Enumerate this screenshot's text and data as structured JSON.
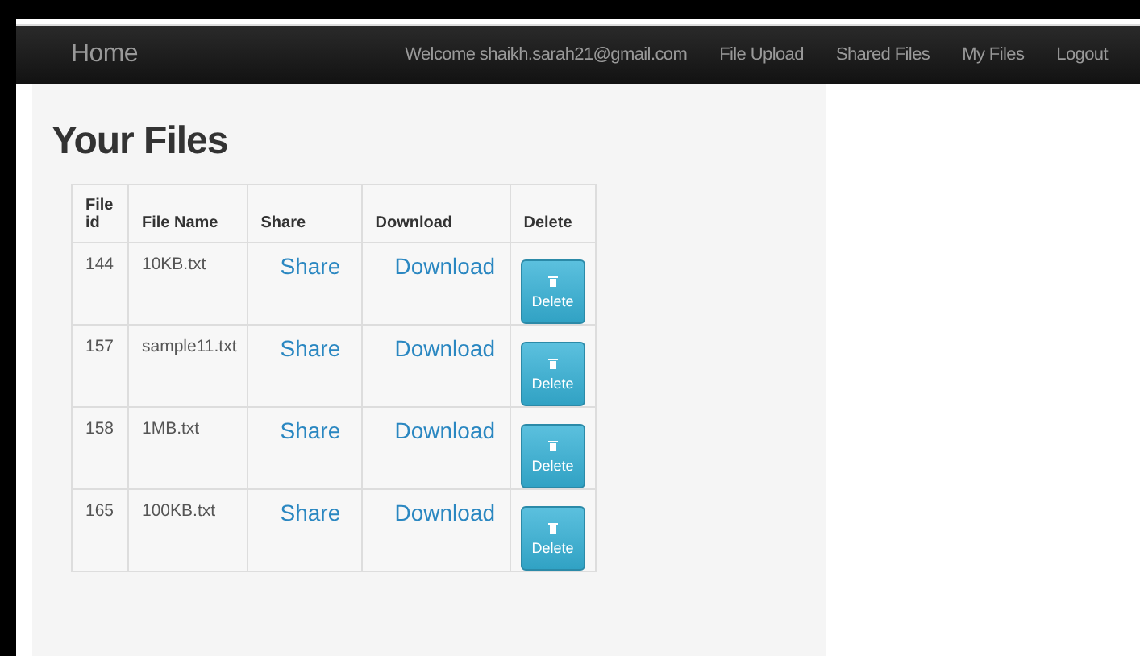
{
  "navbar": {
    "brand": "Home",
    "welcome": "Welcome shaikh.sarah21@gmail.com",
    "links": [
      "File Upload",
      "Shared Files",
      "My Files",
      "Logout"
    ]
  },
  "heading": "Your Files",
  "table": {
    "columns": [
      "File id",
      "File Name",
      "Share",
      "Download",
      "Delete"
    ],
    "rows": [
      {
        "id": "144",
        "name": "10KB.txt",
        "share": "Share",
        "download": "Download",
        "delete": "Delete"
      },
      {
        "id": "157",
        "name": "sample11.txt",
        "share": "Share",
        "download": "Download",
        "delete": "Delete"
      },
      {
        "id": "158",
        "name": "1MB.txt",
        "share": "Share",
        "download": "Download",
        "delete": "Delete"
      },
      {
        "id": "165",
        "name": "100KB.txt",
        "share": "Share",
        "download": "Download",
        "delete": "Delete"
      }
    ]
  }
}
